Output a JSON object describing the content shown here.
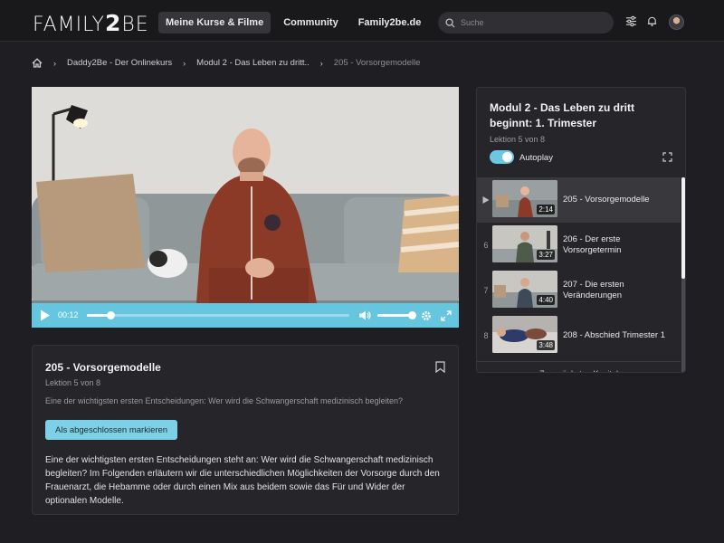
{
  "header": {
    "logo_left": "FAMILY",
    "logo_num": "2",
    "logo_right": "BE",
    "nav": [
      {
        "label": "Meine Kurse & Filme",
        "active": true
      },
      {
        "label": "Community",
        "active": false
      },
      {
        "label": "Family2be.de",
        "active": false
      }
    ],
    "search_placeholder": "Suche"
  },
  "breadcrumb": {
    "items": [
      "Daddy2Be - Der Onlinekurs",
      "Modul 2 - Das Leben zu dritt..",
      "205 - Vorsorgemodelle"
    ]
  },
  "player": {
    "time": "00:12",
    "progress": 0.09,
    "volume": 1.0
  },
  "lesson": {
    "title": "205 - Vorsorgemodelle",
    "subtitle": "Lektion 5 von 8",
    "question": "Eine der wichtigsten ersten Entscheidungen: Wer wird die Schwangerschaft medizinisch begleiten?",
    "button_label": "Als abgeschlossen markieren",
    "description": "Eine der wichtigsten ersten Entscheidungen steht an: Wer wird die Schwangerschaft medizinisch begleiten? Im Folgenden erläutern wir die unterschiedlichen Möglichkeiten der Vorsorge durch den Frauenarzt, die Hebamme oder durch einen Mix aus beidem sowie das Für und Wider der optionalen Modelle."
  },
  "module": {
    "title": "Modul 2 - Das Leben zu dritt beginnt: 1. Trimester",
    "subtitle": "Lektion 5 von 8",
    "autoplay_label": "Autoplay",
    "autoplay_on": true,
    "items": [
      {
        "num": "",
        "duration": "2:14",
        "label": "205 - Vorsorgemodelle",
        "active": true
      },
      {
        "num": "6",
        "duration": "3:27",
        "label": "206 - Der erste Vorsorgetermin",
        "active": false
      },
      {
        "num": "7",
        "duration": "4:40",
        "label": "207 - Die ersten Veränderungen",
        "active": false
      },
      {
        "num": "8",
        "duration": "3:48",
        "label": "208 - Abschied Trimester 1",
        "active": false
      }
    ],
    "more_label": "Zum nächsten Kapitel"
  },
  "colors": {
    "accent": "#67c6df",
    "background": "#1f1f23",
    "panel": "#26262a"
  }
}
